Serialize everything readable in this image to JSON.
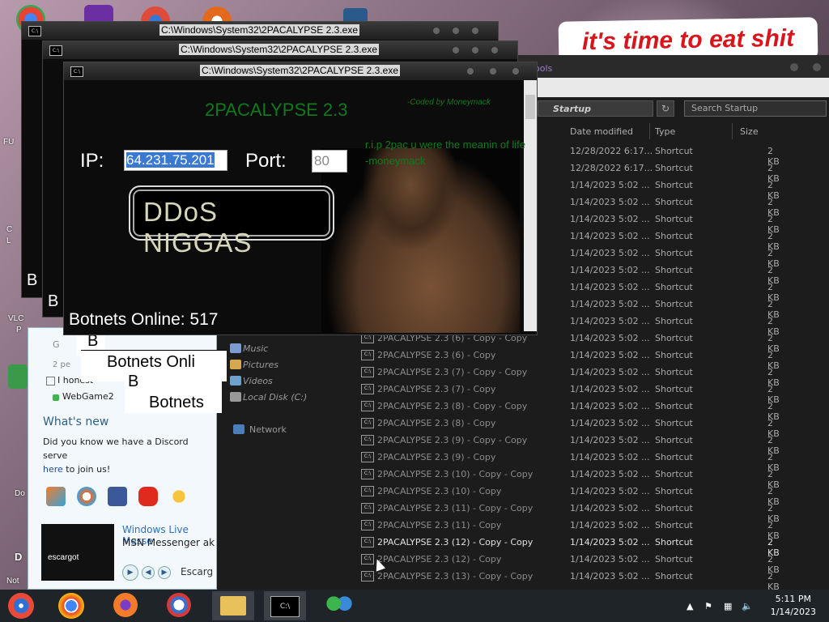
{
  "wallpaper": {
    "banner_text": "it's time to eat shit"
  },
  "desktop_labels": [
    "FU",
    "C",
    "L",
    "VLC",
    "P",
    "Do",
    "D",
    "Not"
  ],
  "msn": {
    "contacts": [
      {
        "text": "G"
      },
      {
        "text": "I honest"
      },
      {
        "text": "WebGame2"
      }
    ],
    "sub_text": "2 pe",
    "whats_new": "What's new",
    "news_line1": "Did you know we have a Discord serve",
    "news_link": "here",
    "news_after_link": " to join us!",
    "promo_logo": "escargot",
    "promo_title": "Windows Live Messe",
    "promo_text": "MSN Messenger ak",
    "escargot_label": "Escarg"
  },
  "cmd_windows": {
    "title": "C:\\Windows\\System32\\2PACALYPSE 2.3.exe",
    "back_b": "B",
    "back_botnets": "Botnets Onli",
    "back_botnets2": "Botnets"
  },
  "app": {
    "title": "2PACALYPSE  2.3",
    "coded_by": "-Coded by Moneymack",
    "rip_text": "r.i.p 2pac u were the meanin of life -moneymack",
    "ip_label": "IP:",
    "ip_value": "64.231.75.201",
    "port_label": "Port:",
    "port_value": "80",
    "ddos_button": "DDoS NIGGAS",
    "botnets_online": "Botnets Online: 517"
  },
  "explorer": {
    "tools_tab": "ools",
    "breadcrumb": "Startup",
    "search_placeholder": "Search Startup",
    "columns": [
      "Date modified",
      "Type",
      "Size"
    ],
    "nav": [
      {
        "label": "Music",
        "color": "#7b9bd1"
      },
      {
        "label": "Pictures",
        "color": "#d6a84d"
      },
      {
        "label": "Videos",
        "color": "#6fa1cf"
      },
      {
        "label": "Local Disk (C:)",
        "color": "#999999"
      },
      {
        "label": "Network",
        "color": "#4c7fb8"
      }
    ],
    "rows": [
      {
        "name": "",
        "date": "12/28/2022 6:17...",
        "type": "Shortcut",
        "size": "2 KB"
      },
      {
        "name": "",
        "date": "12/28/2022 6:17...",
        "type": "Shortcut",
        "size": "2 KB"
      },
      {
        "name": "",
        "date": "1/14/2023 5:02 ...",
        "type": "Shortcut",
        "size": "2 KB"
      },
      {
        "name": "",
        "date": "1/14/2023 5:02 ...",
        "type": "Shortcut",
        "size": "2 KB"
      },
      {
        "name": "",
        "date": "1/14/2023 5:02 ...",
        "type": "Shortcut",
        "size": "2 KB"
      },
      {
        "name": "",
        "date": "1/14/2023 5:02 ...",
        "type": "Shortcut",
        "size": "2 KB"
      },
      {
        "name": "",
        "date": "1/14/2023 5:02 ...",
        "type": "Shortcut",
        "size": "2 KB"
      },
      {
        "name": "",
        "date": "1/14/2023 5:02 ...",
        "type": "Shortcut",
        "size": "2 KB"
      },
      {
        "name": "",
        "date": "1/14/2023 5:02 ...",
        "type": "Shortcut",
        "size": "2 KB"
      },
      {
        "name": "",
        "date": "1/14/2023 5:02 ...",
        "type": "Shortcut",
        "size": "2 KB"
      },
      {
        "name": "",
        "date": "1/14/2023 5:02 ...",
        "type": "Shortcut",
        "size": "2 KB"
      },
      {
        "name": "2PACALYPSE 2.3 (6) - Copy - Copy",
        "date": "1/14/2023 5:02 ...",
        "type": "Shortcut",
        "size": "2 KB"
      },
      {
        "name": "2PACALYPSE 2.3 (6) - Copy",
        "date": "1/14/2023 5:02 ...",
        "type": "Shortcut",
        "size": "2 KB"
      },
      {
        "name": "2PACALYPSE 2.3 (7) - Copy - Copy",
        "date": "1/14/2023 5:02 ...",
        "type": "Shortcut",
        "size": "2 KB"
      },
      {
        "name": "2PACALYPSE 2.3 (7) - Copy",
        "date": "1/14/2023 5:02 ...",
        "type": "Shortcut",
        "size": "2 KB"
      },
      {
        "name": "2PACALYPSE 2.3 (8) - Copy - Copy",
        "date": "1/14/2023 5:02 ...",
        "type": "Shortcut",
        "size": "2 KB"
      },
      {
        "name": "2PACALYPSE 2.3 (8) - Copy",
        "date": "1/14/2023 5:02 ...",
        "type": "Shortcut",
        "size": "2 KB"
      },
      {
        "name": "2PACALYPSE 2.3 (9) - Copy - Copy",
        "date": "1/14/2023 5:02 ...",
        "type": "Shortcut",
        "size": "2 KB"
      },
      {
        "name": "2PACALYPSE 2.3 (9) - Copy",
        "date": "1/14/2023 5:02 ...",
        "type": "Shortcut",
        "size": "2 KB"
      },
      {
        "name": "2PACALYPSE 2.3 (10) - Copy - Copy",
        "date": "1/14/2023 5:02 ...",
        "type": "Shortcut",
        "size": "2 KB"
      },
      {
        "name": "2PACALYPSE 2.3 (10) - Copy",
        "date": "1/14/2023 5:02 ...",
        "type": "Shortcut",
        "size": "2 KB"
      },
      {
        "name": "2PACALYPSE 2.3 (11) - Copy - Copy",
        "date": "1/14/2023 5:02 ...",
        "type": "Shortcut",
        "size": "2 KB"
      },
      {
        "name": "2PACALYPSE 2.3 (11) - Copy",
        "date": "1/14/2023 5:02 ...",
        "type": "Shortcut",
        "size": "2 KB"
      },
      {
        "name": "2PACALYPSE 2.3 (12) - Copy - Copy",
        "date": "1/14/2023 5:02 ...",
        "type": "Shortcut",
        "size": "2 KB",
        "highlight": true
      },
      {
        "name": "2PACALYPSE 2.3 (12) - Copy",
        "date": "1/14/2023 5:02 ...",
        "type": "Shortcut",
        "size": "2 KB"
      },
      {
        "name": "2PACALYPSE 2.3 (13) - Copy - Copy",
        "date": "1/14/2023 5:02 ...",
        "type": "Shortcut",
        "size": "2 KB"
      }
    ]
  },
  "taskbar": {
    "time": "5:11 PM",
    "date": "1/14/2023",
    "apps": [
      "start-icon",
      "chrome-icon",
      "firefox-icon",
      "obama-icon",
      "folder-icon",
      "cmd-icon",
      "msn-icon"
    ]
  }
}
